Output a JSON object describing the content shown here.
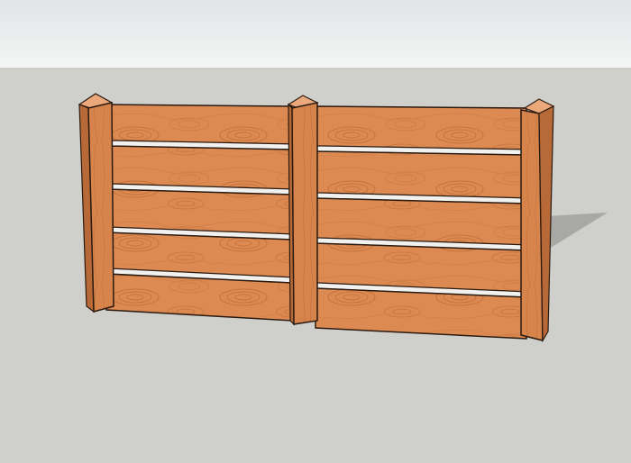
{
  "scene": {
    "subject": "fence",
    "posts": 3,
    "boards_per_bay": 5,
    "colors": {
      "sky_top": "#e4e7e8",
      "sky_bottom": "#f3f4f4",
      "ground": "#cfcfcc",
      "wood_light": "#e0915c",
      "wood_mid": "#d8834a",
      "wood_dark": "#b86a36",
      "wood_grain": "#c47640",
      "post_front": "#d6844c",
      "post_side": "#b76a37",
      "post_top": "#e9a679",
      "outline": "#2a1a10",
      "shadow": "#a9a9a6",
      "gap": "#f1f1ef"
    }
  }
}
